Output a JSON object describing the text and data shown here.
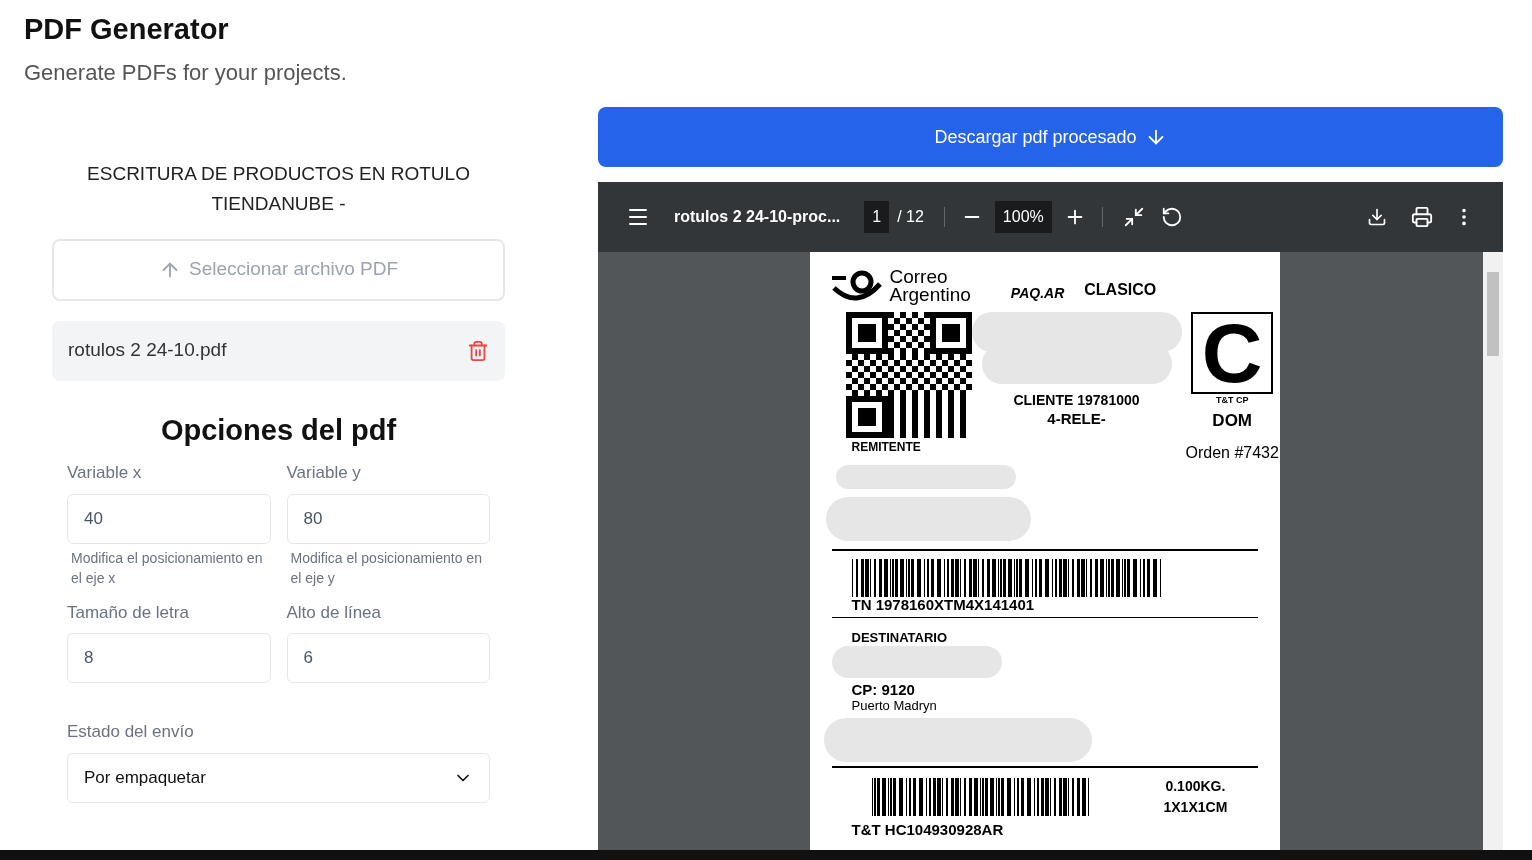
{
  "header": {
    "title": "PDF Generator",
    "subtitle": "Generate PDFs for your projects."
  },
  "left_panel": {
    "section_title": "ESCRITURA DE PRODUCTOS EN ROTULO TIENDANUBE -",
    "upload_button": "Seleccionar archivo PDF",
    "file": {
      "name": "rotulos 2 24-10.pdf"
    },
    "options_title": "Opciones del pdf",
    "fields": [
      {
        "label": "Variable x",
        "value": "40",
        "help": "Modifica el posicionamiento en el eje x"
      },
      {
        "label": "Variable y",
        "value": "80",
        "help": "Modifica el posicionamiento en el eje y"
      },
      {
        "label": "Tamaño de letra",
        "value": "8"
      },
      {
        "label": "Alto de línea",
        "value": "6"
      }
    ],
    "status_select": {
      "label": "Estado del envío",
      "value": "Por empaquetar"
    }
  },
  "download_button": "Descargar pdf procesado",
  "viewer": {
    "file_name": "rotulos 2 24-10-proc...",
    "page": "1",
    "page_total": "/ 12",
    "zoom": "100%",
    "label": {
      "brand_line_1": "Correo",
      "brand_line_2": "Argentino",
      "product": "PAQ.AR",
      "service": "CLASICO",
      "big_letter": "C",
      "tt_cp": "T&T CP",
      "dom": "DOM",
      "client": "CLIENTE 19781000",
      "client_code": "4-RELE-",
      "sender": "REMITENTE",
      "order": "Orden #7432",
      "tn": "TN 1978160XTM4X141401",
      "recipient": "DESTINATARIO",
      "cp": "CP: 9120",
      "city": "Puerto Madryn",
      "weight": "0.100KG.",
      "dimensions": "1X1X1CM",
      "tracking": "T&T HC104930928AR"
    }
  }
}
